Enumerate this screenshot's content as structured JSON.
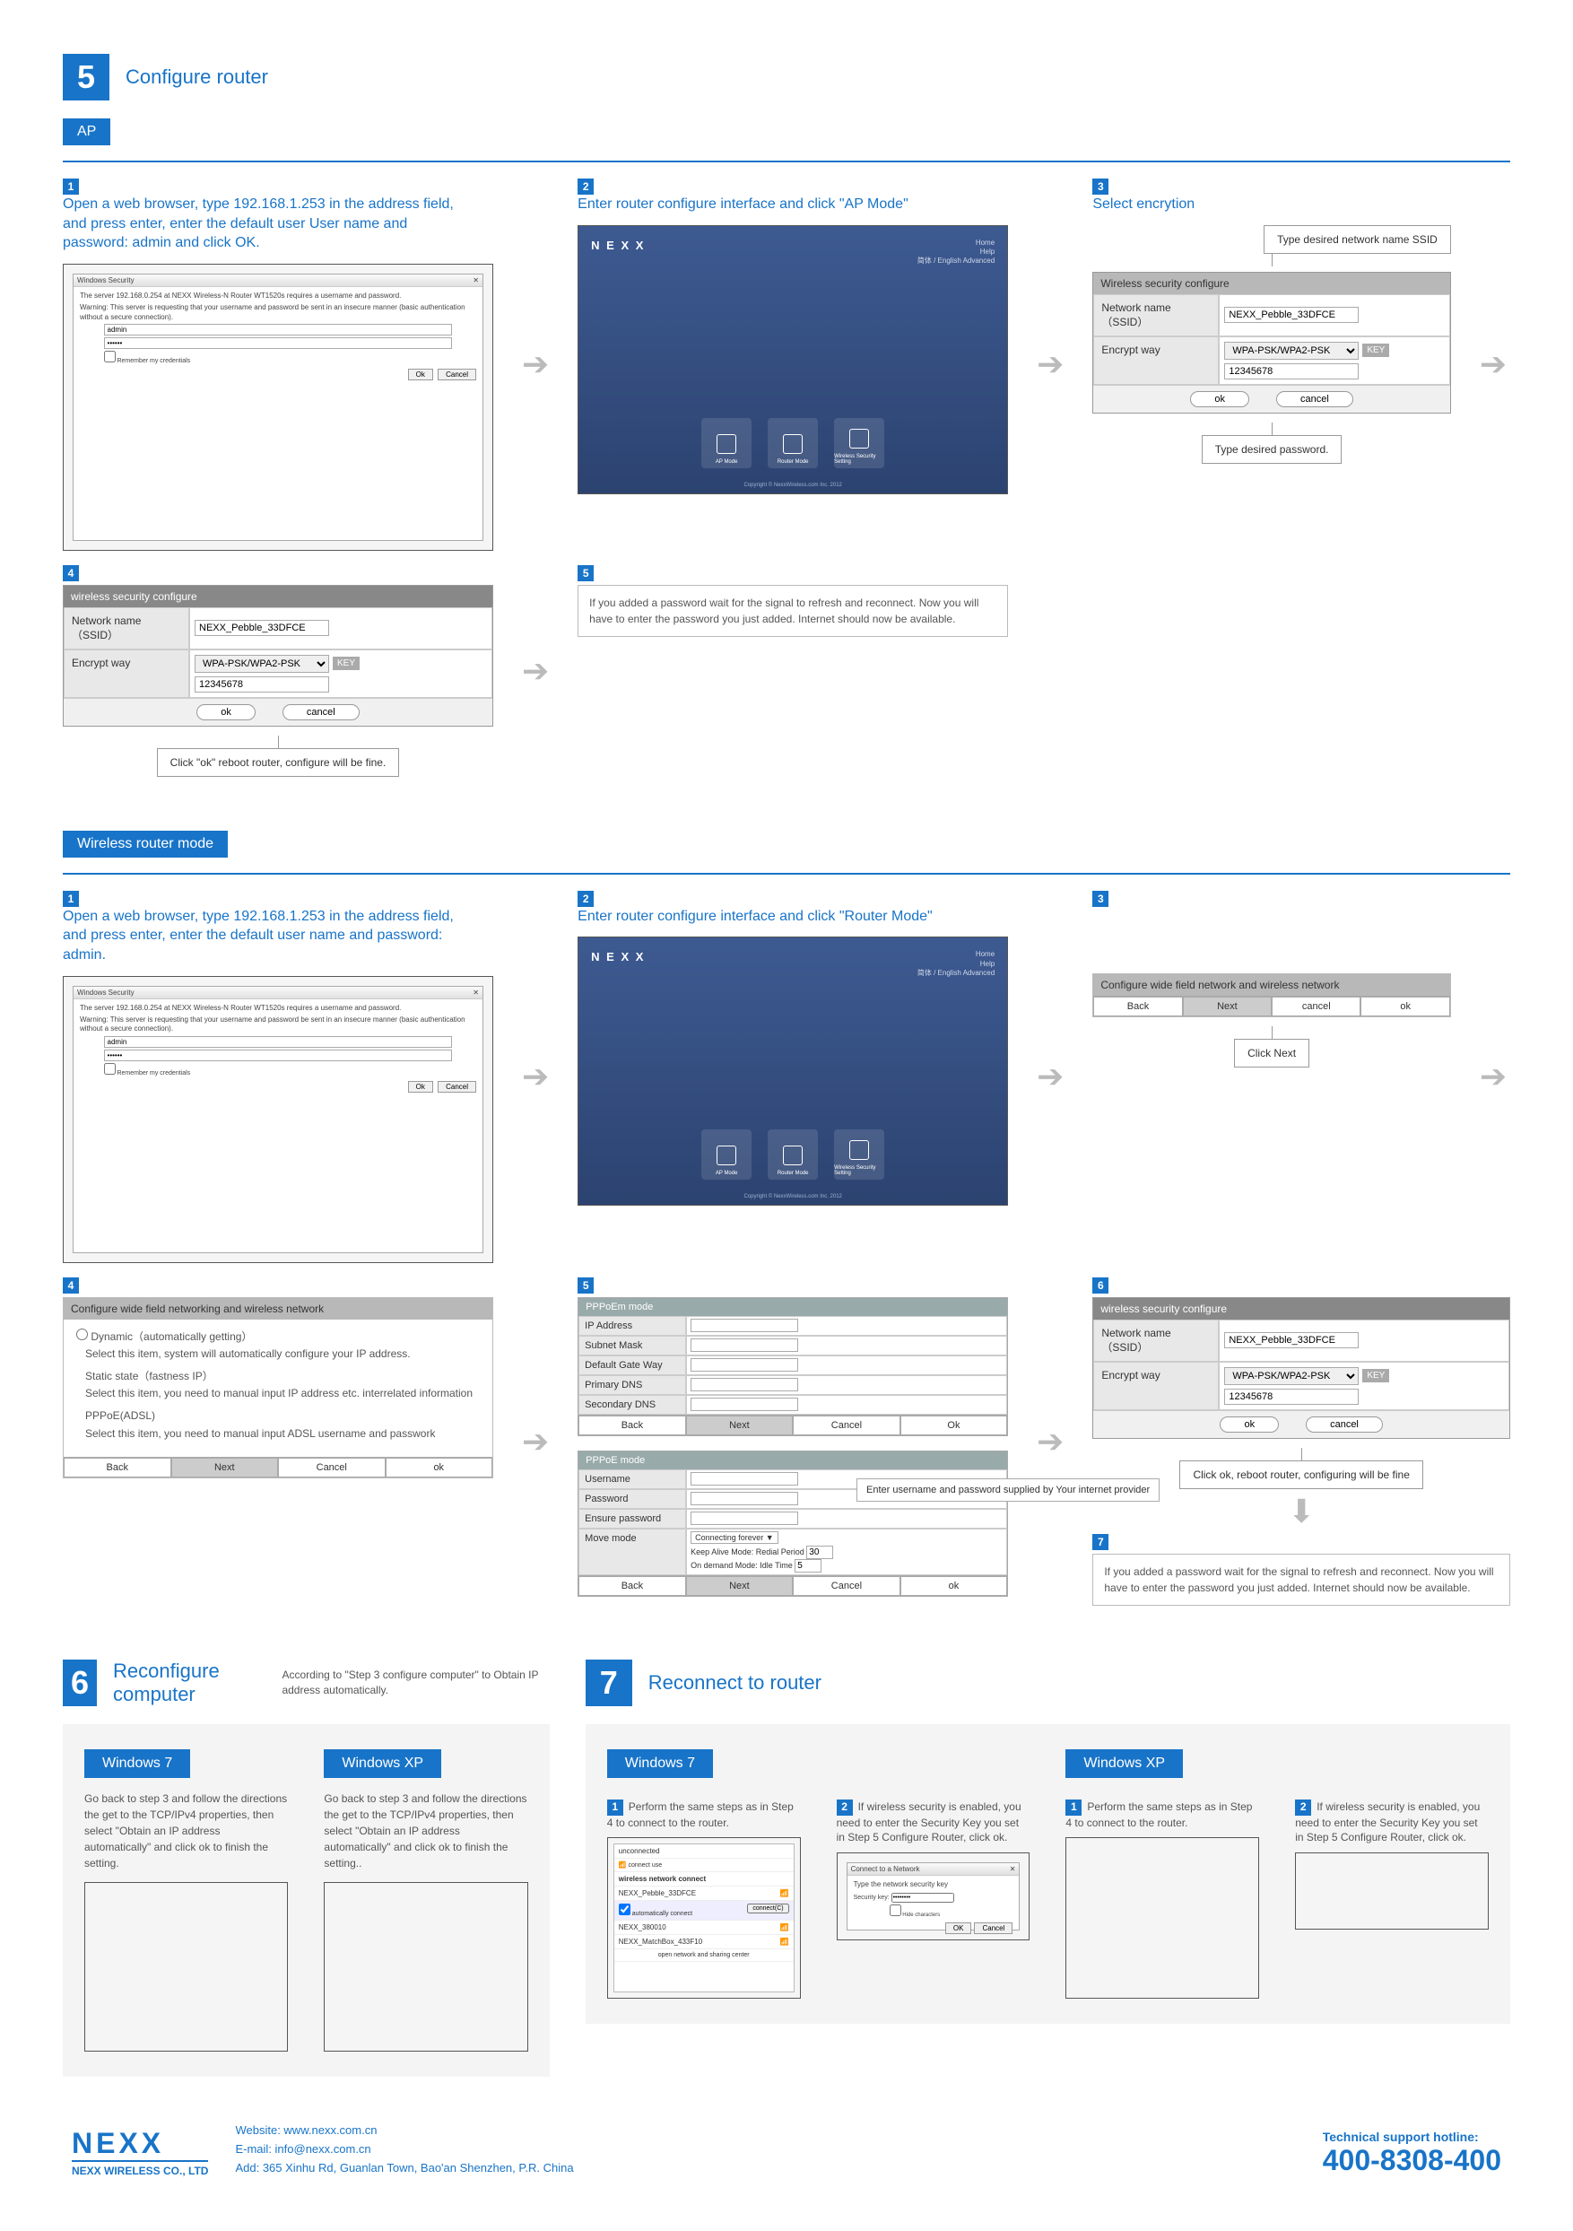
{
  "section5": {
    "num": "5",
    "title": "Configure router",
    "ap": {
      "header": "AP",
      "step1": {
        "num": "1",
        "text": "Open a web browser, type 192.168.1.253 in the address field, and press enter, enter the default user User name and password: admin and click OK."
      },
      "step2": {
        "num": "2",
        "text": "Enter router configure interface and click \"AP Mode\""
      },
      "step3": {
        "num": "3",
        "text": "Select encrytion"
      },
      "step3_callout_top": "Type desired network name SSID",
      "step3_callout_bottom": "Type desired password.",
      "step4": {
        "num": "4"
      },
      "step4_callout": "Click \"ok\" reboot router, configure will be fine.",
      "step5": {
        "num": "5",
        "note": "If you added a password wait for the signal to refresh and reconnect.  Now you will have to enter the password you just added.  Internet should now be available."
      },
      "wireless_panel": {
        "title": "Wireless security configure",
        "ssid_label": "Network name（SSID）",
        "ssid_value": "NEXX_Pebble_33DFCE",
        "encrypt_label": "Encrypt way",
        "encrypt_value": "WPA-PSK/WPA2-PSK",
        "key_label": "KEY",
        "key_value": "12345678",
        "ok": "ok",
        "cancel": "cancel"
      },
      "wireless_panel2_title": "wireless security configure"
    },
    "router_mode": {
      "header": "Wireless router mode",
      "step1": {
        "num": "1",
        "text": "Open a web browser, type 192.168.1.253 in the address field, and press enter, enter the default user name and password: admin."
      },
      "step2": {
        "num": "2",
        "text": "Enter router configure interface and click \"Router Mode\""
      },
      "step3": {
        "num": "3"
      },
      "step3_panel_title": "Configure wide field network and wireless network",
      "step3_btns": {
        "back": "Back",
        "next": "Next",
        "cancel": "cancel",
        "ok": "ok"
      },
      "step3_callout": "Click Next",
      "step4": {
        "num": "4"
      },
      "step4_panel_title": "Configure wide field networking and wireless network",
      "step4_options": {
        "dynamic_title": "Dynamic（automatically getting）",
        "dynamic_desc": "Select this item, system will automatically configure your IP address.",
        "static_title": "Static state（fastness IP）",
        "static_desc": "Select this item, you need to manual input IP address etc. interrelated information",
        "pppoe_title": "PPPoE(ADSL)",
        "pppoe_desc": "Select this item, you need to manual input ADSL username and passwork"
      },
      "step4_btns": {
        "back": "Back",
        "next": "Next",
        "cancel": "Cancel",
        "ok": "ok"
      },
      "step5": {
        "num": "5"
      },
      "step5_pppoe_m": {
        "title": "PPPoEm mode",
        "rows": {
          "ip": "IP Address",
          "mask": "Subnet Mask",
          "gw": "Default Gate Way",
          "pdns": "Primary DNS",
          "sdns": "Secondary DNS"
        },
        "btns": {
          "back": "Back",
          "next": "Next",
          "cancel": "Cancel",
          "ok": "Ok"
        }
      },
      "step5_pppoe": {
        "title": "PPPoE mode",
        "rows": {
          "user": "Username",
          "pass": "Password",
          "epass": "Ensure password",
          "move": "Move mode"
        },
        "conn_forever": "Connecting forever",
        "keep_alive": "Keep Alive Mode: Redial Period",
        "keep_alive_val": "30",
        "on_demand": "On demand Mode: Idle Time",
        "on_demand_val": "5",
        "callout": "Enter username and password supplied by Your internet provider",
        "btns": {
          "back": "Back",
          "next": "Next",
          "cancel": "Cancel",
          "ok": "ok"
        }
      },
      "step6": {
        "num": "6"
      },
      "step6_panel_title": "wireless security configure",
      "step6_callout": "Click ok, reboot router, configuring will be fine",
      "step7": {
        "num": "7",
        "note": "If you added a password wait for the signal to refresh and reconnect.  Now you will have to enter the password you just added.  Internet should now be available."
      }
    },
    "nexx_screenshot": {
      "logo": "N E X X",
      "menu": "Home\nHelp\n简体 / English    Advanced",
      "icon1": "AP Mode",
      "icon2": "Router Mode",
      "icon3": "Wireless Security Setting",
      "copy": "Copyright © NexxWireless.com Inc. 2012"
    },
    "win_dialog": {
      "title": "Windows Security",
      "line1": "The server 192.168.0.254 at  NEXX  Wireless-N Router WT1520s requires a username and password.",
      "line2": "Warning: This server is requesting that your username and password be sent in an insecure manner (basic authentication without a secure connection).",
      "user": "admin",
      "pass": "••••••",
      "remember": "Remember my credentials",
      "ok": "Ok",
      "cancel": "Cancel"
    }
  },
  "section6": {
    "num": "6",
    "title": "Reconfigure computer",
    "subtext": "According to \"Step 3 configure computer\" to Obtain IP address automatically.",
    "win7": {
      "header": "Windows 7",
      "desc": "Go back to step 3 and follow the directions the get to the TCP/IPv4 properties, then select \"Obtain an IP address automatically\" and click ok to finish the setting."
    },
    "winxp": {
      "header": "Windows XP",
      "desc": "Go back to step 3 and follow the directions the get to the TCP/IPv4 properties, then select \"Obtain an IP address automatically\" and click ok to finish the setting.."
    }
  },
  "section7": {
    "num": "7",
    "title": "Reconnect to router",
    "win7": {
      "header": "Windows 7",
      "step1": {
        "num": "1",
        "text": "Perform the same steps as in Step 4 to connect to the router."
      },
      "step2": {
        "num": "2",
        "text": "If wireless security is enabled, you need to enter the Security Key you set in Step 5 Configure Router, click ok."
      },
      "list": {
        "unconnected": "unconnected",
        "connect_use": "connect use",
        "wnc": "wireless network connect",
        "item1": "NEXX_Pebble_33DFCE",
        "auto": "automatically connect",
        "connect_btn": "connect(C)",
        "item2": "NEXX_380010",
        "item3": "NEXX_MatchBox_433F10",
        "footer": "open network and sharing center"
      },
      "sec_dialog": {
        "title": "Connect to a Network",
        "prompt": "Type the network security key",
        "label": "Security key:",
        "val": "••••••••",
        "hide": "Hide characters",
        "ok": "OK",
        "cancel": "Cancel"
      }
    },
    "winxp": {
      "header": "Windows XP",
      "step1": {
        "num": "1",
        "text": "Perform the same steps as in Step 4 to connect to the router."
      },
      "step2": {
        "num": "2",
        "text": "If wireless security is enabled, you need to enter the Security Key you set in Step 5 Configure Router, click ok."
      }
    }
  },
  "footer": {
    "brand": "NEXX",
    "brand_sub": "NEXX WIRELESS CO., LTD",
    "website_label": "Website: ",
    "website": "www.nexx.com.cn",
    "email_label": "E-mail: ",
    "email": "info@nexx.com.cn",
    "addr_label": "Add: ",
    "addr": "365 Xinhu Rd, Guanlan Town, Bao'an Shenzhen, P.R. China",
    "hotline_label": "Technical support hotline:",
    "hotline": "400-8308-400"
  }
}
